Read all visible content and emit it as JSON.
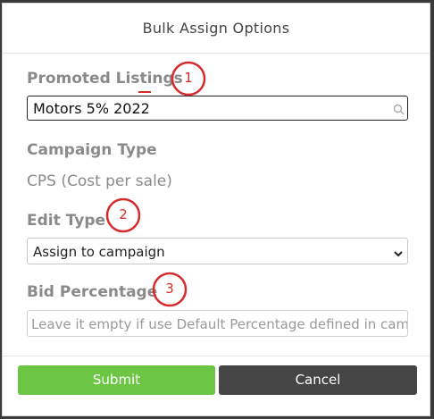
{
  "dialog": {
    "title": "Bulk Assign Options",
    "promoted_listings": {
      "label": "Promoted Listings",
      "value": "Motors 5% 2022",
      "icon": "search-icon"
    },
    "campaign_type": {
      "label": "Campaign Type",
      "value": "CPS (Cost per sale)"
    },
    "edit_type": {
      "label": "Edit Type",
      "selected": "Assign to campaign",
      "icon": "chevron-down-icon"
    },
    "bid_percentage": {
      "label": "Bid Percentage",
      "placeholder": "Leave it empty if use Default Percentage defined in campaign"
    },
    "buttons": {
      "submit": "Submit",
      "cancel": "Cancel"
    }
  },
  "annotations": [
    "1",
    "2",
    "3"
  ],
  "colors": {
    "submit": "#6cc644",
    "cancel": "#454545",
    "annotation": "#d62b2b"
  }
}
